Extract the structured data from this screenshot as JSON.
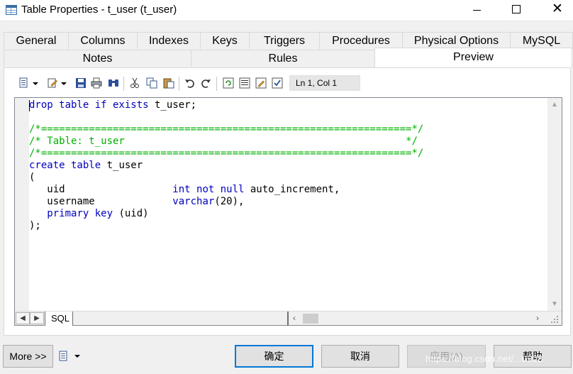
{
  "window": {
    "title": "Table Properties - t_user (t_user)",
    "close_glyph": "✕"
  },
  "tabs_row1": [
    "General",
    "Columns",
    "Indexes",
    "Keys",
    "Triggers",
    "Procedures",
    "Physical Options",
    "MySQL"
  ],
  "tabs_row2": [
    "Notes",
    "Rules",
    "Preview"
  ],
  "active_tab": "Preview",
  "toolbar": {
    "icons": [
      "properties-icon",
      "edit-icon",
      "save-icon",
      "print-icon",
      "find-icon",
      "cut-icon",
      "copy-icon",
      "paste-icon",
      "undo-icon",
      "redo-icon",
      "refresh-icon",
      "list-icon",
      "edit-window-icon",
      "check-icon"
    ],
    "cursor_position": "Ln 1, Col 1"
  },
  "code_lines": [
    [
      {
        "t": "drop table if exists",
        "c": "kw"
      },
      {
        "t": " t_user;",
        "c": ""
      }
    ],
    [],
    [
      {
        "t": "/*==============================================================*/",
        "c": "cm"
      }
    ],
    [
      {
        "t": "/* Table: t_user                                               */",
        "c": "cm"
      }
    ],
    [
      {
        "t": "/*==============================================================*/",
        "c": "cm"
      }
    ],
    [
      {
        "t": "create table",
        "c": "kw"
      },
      {
        "t": " t_user",
        "c": ""
      }
    ],
    [
      {
        "t": "(",
        "c": ""
      }
    ],
    [
      {
        "t": "   uid                  ",
        "c": ""
      },
      {
        "t": "int not null",
        "c": "kw"
      },
      {
        "t": " auto_increment,",
        "c": ""
      }
    ],
    [
      {
        "t": "   username             ",
        "c": ""
      },
      {
        "t": "varchar",
        "c": "kw"
      },
      {
        "t": "(20),",
        "c": ""
      }
    ],
    [
      {
        "t": "   ",
        "c": ""
      },
      {
        "t": "primary key",
        "c": "kw"
      },
      {
        "t": " (uid)",
        "c": ""
      }
    ],
    [
      {
        "t": ");",
        "c": ""
      }
    ]
  ],
  "editor_tab": "SQL",
  "buttons": {
    "more": "More >>",
    "ok": "确定",
    "cancel": "取消",
    "apply": "应用(A)",
    "help": "帮助"
  },
  "watermark": "https://blog.csdn.net/...0908",
  "colors": {
    "keyword": "#0000c0",
    "comment": "#00b000",
    "accent": "#0078d7"
  }
}
